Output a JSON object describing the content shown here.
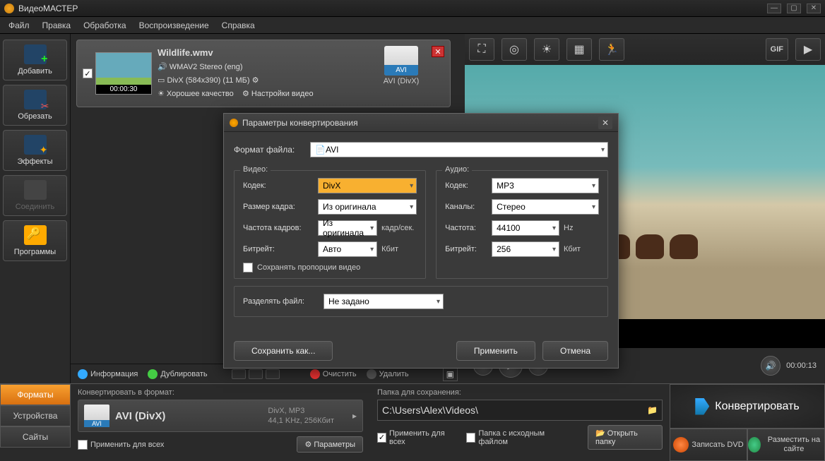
{
  "app": {
    "title": "ВидеоМАСТЕР"
  },
  "menu": {
    "file": "Файл",
    "edit": "Правка",
    "process": "Обработка",
    "playback": "Воспроизведение",
    "help": "Справка"
  },
  "sidebar": {
    "add": "Добавить",
    "cut": "Обрезать",
    "fx": "Эффекты",
    "join": "Соединить",
    "programs": "Программы"
  },
  "topbtn": {
    "gif": "GIF"
  },
  "file": {
    "name": "Wildlife.wmv",
    "audio": "WMAV2 Stereo (eng)",
    "video": "DivX (584x390) (11 МБ)",
    "quality": "Хорошее качество",
    "settings": "Настройки видео",
    "duration": "00:00:30",
    "out_tag": "AVI",
    "out_label": "AVI (DivX)"
  },
  "actions": {
    "info": "Информация",
    "dup": "Дублировать",
    "clear": "Очистить",
    "delete": "Удалить"
  },
  "player": {
    "time": "00:00:13"
  },
  "bottom": {
    "tab_formats": "Форматы",
    "tab_devices": "Устройства",
    "tab_sites": "Сайты",
    "convert_to": "Конвертировать в формат:",
    "fmt_tag": "AVI",
    "fmt_name": "AVI (DivX)",
    "fmt_desc1": "DivX, MP3",
    "fmt_desc2": "44,1 KHz, 256Кбит",
    "apply_all": "Применить для всех",
    "params": "Параметры",
    "save_folder": "Папка для сохранения:",
    "path": "C:\\Users\\Alex\\Videos\\",
    "apply_all2": "Применить для всех",
    "with_source": "Папка с исходным файлом",
    "open_folder": "Открыть папку",
    "convert": "Конвертировать",
    "dvd": "Записать DVD",
    "web": "Разместить на сайте"
  },
  "dialog": {
    "title": "Параметры конвертирования",
    "file_format": "Формат файла:",
    "file_format_val": "AVI",
    "video_legend": "Видео:",
    "audio_legend": "Аудио:",
    "v_codec": "Кодек:",
    "v_codec_val": "DivX",
    "v_size": "Размер кадра:",
    "v_size_val": "Из оригинала",
    "v_fps": "Частота кадров:",
    "v_fps_val": "Из оригинала",
    "v_fps_unit": "кадр/сек.",
    "v_bitrate": "Битрейт:",
    "v_bitrate_val": "Авто",
    "v_bitrate_unit": "Кбит",
    "keep_aspect": "Сохранять пропорции видео",
    "a_codec": "Кодек:",
    "a_codec_val": "MP3",
    "a_channels": "Каналы:",
    "a_channels_val": "Стерео",
    "a_freq": "Частота:",
    "a_freq_val": "44100",
    "a_freq_unit": "Hz",
    "a_bitrate": "Битрейт:",
    "a_bitrate_val": "256",
    "a_bitrate_unit": "Кбит",
    "split": "Разделять файл:",
    "split_val": "Не задано",
    "save_as": "Сохранить как...",
    "apply": "Применить",
    "cancel": "Отмена"
  }
}
